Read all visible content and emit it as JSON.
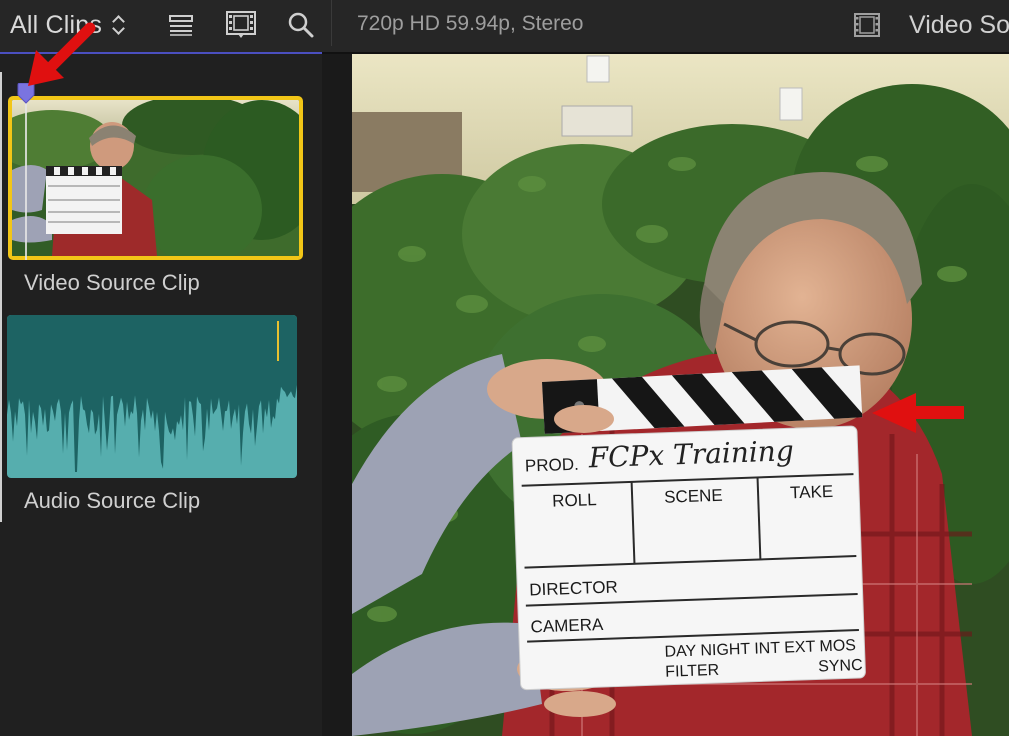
{
  "toolbar": {
    "clips_menu_label": "All Clips",
    "format_info": "720p HD 59.94p, Stereo",
    "viewer_title": "Video Source Clip"
  },
  "browser": {
    "clips": [
      {
        "name": "Video Source Clip",
        "type": "video",
        "selected": true
      },
      {
        "name": "Audio Source Clip",
        "type": "audio",
        "selected": false
      }
    ]
  },
  "viewer": {
    "slate": {
      "prod_label": "PROD.",
      "prod_value": "FCPx Training",
      "roll_label": "ROLL",
      "scene_label": "SCENE",
      "take_label": "TAKE",
      "director_label": "DIRECTOR",
      "camera_label": "CAMERA",
      "options_line_1": "DAY NIGHT INT EXT MOS",
      "options_line_2_left": "FILTER",
      "options_line_2_right": "SYNC"
    }
  },
  "colors": {
    "selection_border": "#f2c617",
    "audio_clip_bg": "#56aeae",
    "audio_waveform": "#1d6363",
    "playhead": "#7a74e0",
    "annotation_arrow": "#e01010",
    "browser_accent": "#4b4fc0"
  },
  "icons": [
    "updown-chevron-icon",
    "list-view-icon",
    "filmstrip-view-icon",
    "search-icon",
    "viewer-display-icon",
    "annotation-arrow-icon"
  ]
}
